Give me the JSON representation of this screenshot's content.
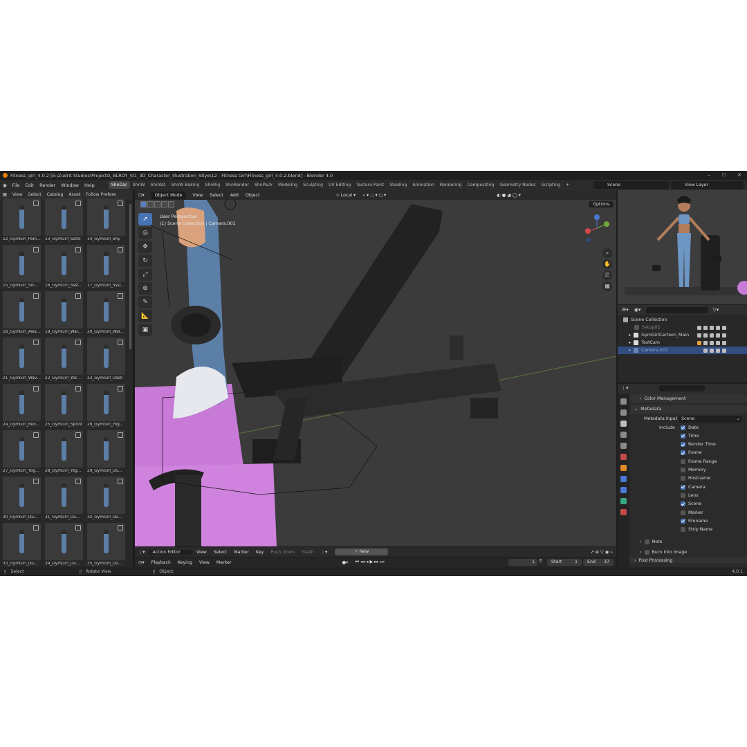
{
  "window": {
    "title": "Fitness_girl_4.0.2 [E:\\Zudrit Studios\\Projects\\_BLRDY_\\01_3D_Character_Illustration_Stlye\\12 - Fitness Girl\\Fitness_girl_4.0.2.blend] - Blender 4.0"
  },
  "menu": {
    "items": [
      "File",
      "Edit",
      "Render",
      "Window",
      "Help"
    ],
    "workspaces": [
      "ShnDar",
      "ShnW",
      "ShnW2",
      "ShnW Baking",
      "ShnRig",
      "ShnRender",
      "ShnPack",
      "Modeling",
      "Sculpting",
      "UV Editing",
      "Texture Paint",
      "Shading",
      "Animation",
      "Rendering",
      "Compositing",
      "Geometry Nodes",
      "Scripting"
    ],
    "scene": "Scene",
    "view_layer": "View Layer"
  },
  "assets": {
    "header": [
      "View",
      "Select",
      "Catalog",
      "Asset",
      "Follow Prefere"
    ],
    "items": [
      "12_GymGirl_Poin…",
      "13_GymGirl_Salto",
      "14_GymGirl_Shy",
      "15_GymGirl_Singl…",
      "16_GymGirl_Ssst…",
      "17_GymGirl_Ssst…",
      "18_GymGirl_Awake",
      "19_GymGirl_Walk…",
      "20_GymGirl_Walk…",
      "21_GymGirl_Wavi…",
      "22_GymGirl_Yes …",
      "23_GymGirl_Dash",
      "24_GymGirl_Runn…",
      "25_GymGirl_Sprint",
      "26_GymGirl_Yog…",
      "27_GymGirl_Yog…",
      "28_GymGirl_Yog…",
      "29_GymGirl_Dum…",
      "30_GymGirl_Dum…",
      "31_GymGirl_Dum…",
      "32_GymGirl_Dum…",
      "33_GymGirl_Dum…",
      "34_GymGirl_Dum…",
      "35_GymGirl_Dum…"
    ]
  },
  "viewport": {
    "mode": "Object Mode",
    "menus": [
      "View",
      "Select",
      "Add",
      "Object"
    ],
    "orientation": "Local",
    "options": "Options",
    "overlay_line1": "User Perspective",
    "overlay_line2": "(1) Scene Collection | Camera.001"
  },
  "action_editor": {
    "mode": "Action Editor",
    "menus": [
      "View",
      "Select",
      "Marker",
      "Key"
    ],
    "push_down": "Push Down",
    "stash": "Stash",
    "new": "New"
  },
  "timeline": {
    "menus": [
      "Playback",
      "Keying",
      "View",
      "Marker"
    ],
    "current_frame": "1",
    "start_label": "Start",
    "start": "1",
    "end_label": "End",
    "end": "37"
  },
  "status": {
    "left": "Select",
    "middle": "Rotate View",
    "right_action": "Object",
    "version": "4.0.1"
  },
  "outliner": {
    "root": "Scene Collection",
    "rows": [
      "Setup02",
      "GymGirlCartoon_Main",
      "TestCam",
      "Camera.001"
    ]
  },
  "properties": {
    "color_management": "Color Management",
    "metadata": "Metadata",
    "metadata_input_label": "Metadata Input",
    "metadata_input": "Scene",
    "include": "Include",
    "fields": [
      {
        "label": "Date",
        "checked": true
      },
      {
        "label": "Time",
        "checked": true
      },
      {
        "label": "Render Time",
        "checked": true
      },
      {
        "label": "Frame",
        "checked": true
      },
      {
        "label": "Frame Range",
        "checked": false
      },
      {
        "label": "Memory",
        "checked": false
      },
      {
        "label": "Hostname",
        "checked": false
      },
      {
        "label": "Camera",
        "checked": true
      },
      {
        "label": "Lens",
        "checked": false
      },
      {
        "label": "Scene",
        "checked": true
      },
      {
        "label": "Marker",
        "checked": false
      },
      {
        "label": "Filename",
        "checked": true
      },
      {
        "label": "Strip Name",
        "checked": false
      }
    ],
    "note": "Note",
    "burn_into_image": "Burn Into Image",
    "post_processing": "Post Processing"
  },
  "colors": {
    "selection": "#4772b3",
    "outliner_selected": "#334d80",
    "yoga_mat": "#c77ad6",
    "jeans": "#5c7fa8"
  }
}
